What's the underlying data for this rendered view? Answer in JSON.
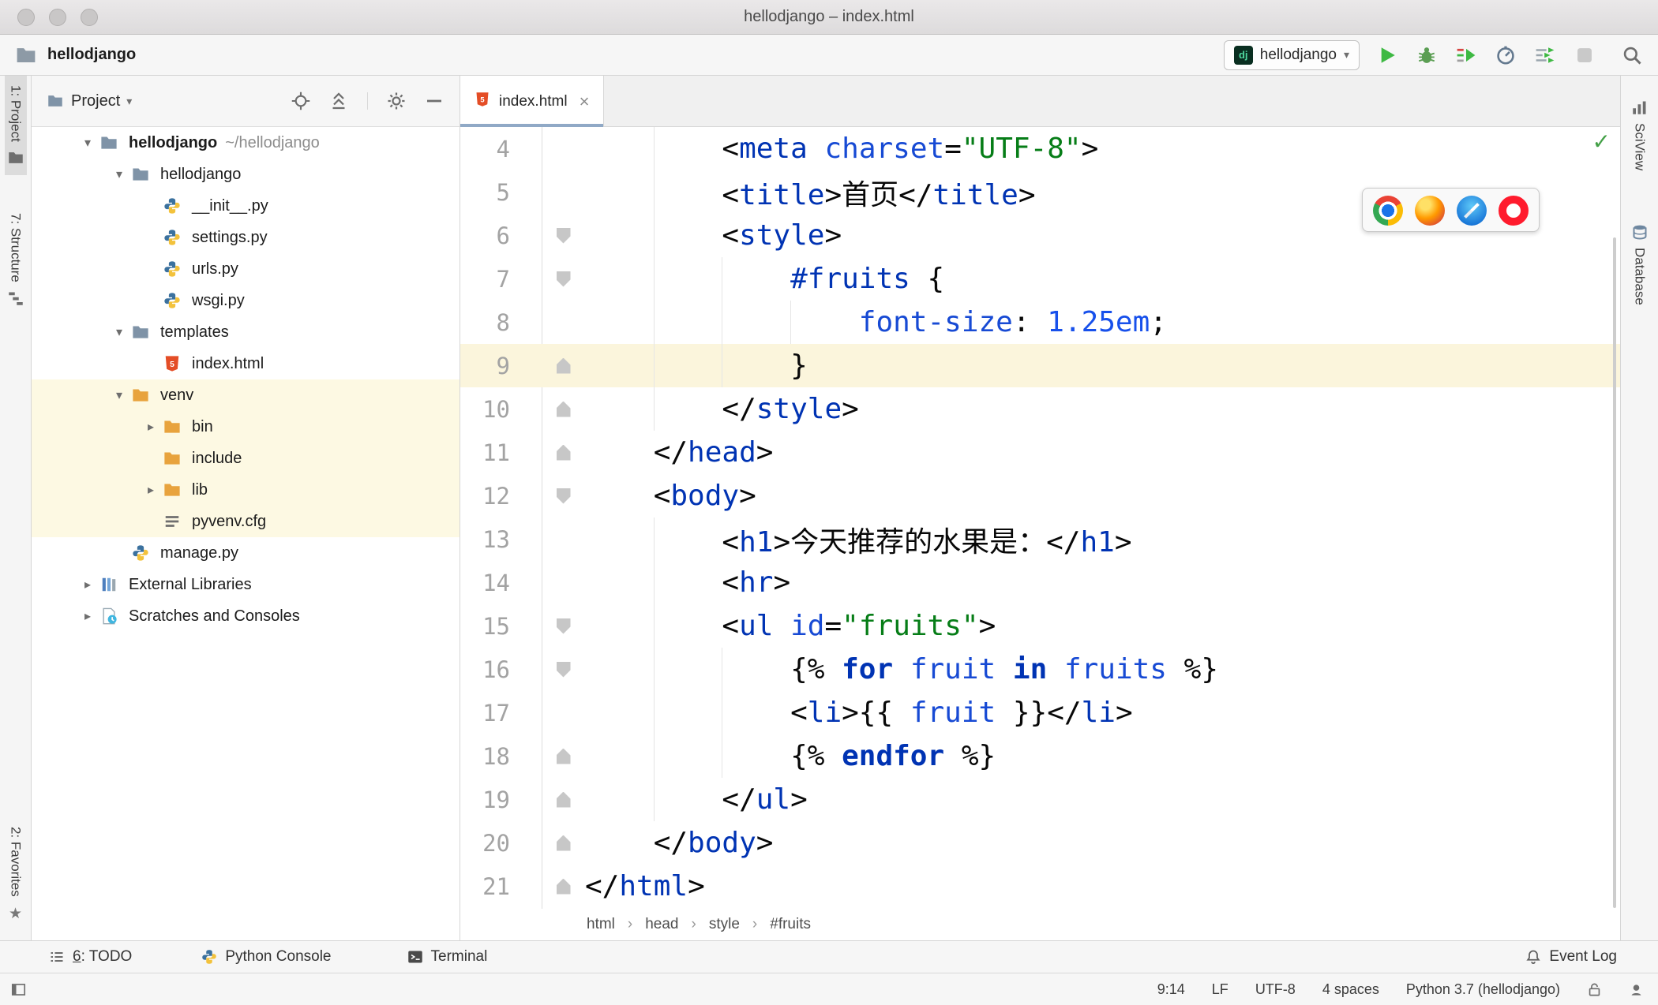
{
  "window": {
    "title": "hellodjango – index.html"
  },
  "toolbar": {
    "project_name": "hellodjango",
    "config_badge": "dj",
    "run_config": "hellodjango"
  },
  "left_stripe": {
    "project": "1: Project",
    "structure": "7: Structure",
    "favorites": "2: Favorites"
  },
  "right_stripe": {
    "sciview": "SciView",
    "database": "Database"
  },
  "project_panel": {
    "header": "Project",
    "tree": [
      {
        "label": "hellodjango",
        "hint": "~/hellodjango",
        "level": 0,
        "icon": "folder",
        "arrow": "down",
        "bold": true
      },
      {
        "label": "hellodjango",
        "level": 1,
        "icon": "folder",
        "arrow": "down"
      },
      {
        "label": "__init__.py",
        "level": 2,
        "icon": "python"
      },
      {
        "label": "settings.py",
        "level": 2,
        "icon": "python"
      },
      {
        "label": "urls.py",
        "level": 2,
        "icon": "python"
      },
      {
        "label": "wsgi.py",
        "level": 2,
        "icon": "python"
      },
      {
        "label": "templates",
        "level": 1,
        "icon": "folder",
        "arrow": "down"
      },
      {
        "label": "index.html",
        "level": 2,
        "icon": "html"
      },
      {
        "label": "venv",
        "level": 1,
        "icon": "folder-orange",
        "arrow": "down",
        "highlight": true
      },
      {
        "label": "bin",
        "level": 2,
        "icon": "folder-orange",
        "arrow": "right",
        "highlight": true
      },
      {
        "label": "include",
        "level": 2,
        "icon": "folder-orange",
        "highlight": true
      },
      {
        "label": "lib",
        "level": 2,
        "icon": "folder-orange",
        "arrow": "right",
        "highlight": true
      },
      {
        "label": "pyvenv.cfg",
        "level": 2,
        "icon": "cfg",
        "highlight": true
      },
      {
        "label": "manage.py",
        "level": 1,
        "icon": "python"
      },
      {
        "label": "External Libraries",
        "level": 0,
        "icon": "libs",
        "arrow": "right"
      },
      {
        "label": "Scratches and Consoles",
        "level": 0,
        "icon": "scratches",
        "arrow": "right"
      }
    ]
  },
  "editor": {
    "tab_label": "index.html",
    "breadcrumbs": [
      "html",
      "head",
      "style",
      "#fruits"
    ],
    "browser_icons": [
      "chrome",
      "firefox",
      "safari",
      "opera"
    ],
    "lines": [
      {
        "num": 4,
        "seg": [
          [
            "p",
            "        <"
          ],
          [
            "t",
            "meta"
          ],
          [
            "p",
            " "
          ],
          [
            "a",
            "charset"
          ],
          [
            "p",
            "="
          ],
          [
            "s",
            "\"UTF-8\""
          ],
          [
            "p",
            ">"
          ]
        ]
      },
      {
        "num": 5,
        "seg": [
          [
            "p",
            "        <"
          ],
          [
            "t",
            "title"
          ],
          [
            "p",
            ">首页</"
          ],
          [
            "t",
            "title"
          ],
          [
            "p",
            ">"
          ]
        ]
      },
      {
        "num": 6,
        "fold": "down",
        "seg": [
          [
            "p",
            "        <"
          ],
          [
            "t",
            "style"
          ],
          [
            "p",
            ">"
          ]
        ]
      },
      {
        "num": 7,
        "fold": "down",
        "seg": [
          [
            "p",
            "            "
          ],
          [
            "t",
            "#fruits"
          ],
          [
            "p",
            " {"
          ]
        ]
      },
      {
        "num": 8,
        "seg": [
          [
            "p",
            "                "
          ],
          [
            "a",
            "font-size"
          ],
          [
            "p",
            ": "
          ],
          [
            "n",
            "1.25em"
          ],
          [
            "p",
            ";"
          ]
        ]
      },
      {
        "num": 9,
        "fold": "up",
        "current": true,
        "seg": [
          [
            "p",
            "            }"
          ]
        ]
      },
      {
        "num": 10,
        "fold": "up",
        "seg": [
          [
            "p",
            "        </"
          ],
          [
            "t",
            "style"
          ],
          [
            "p",
            ">"
          ]
        ]
      },
      {
        "num": 11,
        "fold": "up",
        "seg": [
          [
            "p",
            "    </"
          ],
          [
            "t",
            "head"
          ],
          [
            "p",
            ">"
          ]
        ]
      },
      {
        "num": 12,
        "fold": "down",
        "seg": [
          [
            "p",
            "    <"
          ],
          [
            "t",
            "body"
          ],
          [
            "p",
            ">"
          ]
        ]
      },
      {
        "num": 13,
        "seg": [
          [
            "p",
            "        <"
          ],
          [
            "t",
            "h1"
          ],
          [
            "p",
            ">今天推荐的水果是：</"
          ],
          [
            "t",
            "h1"
          ],
          [
            "p",
            ">"
          ]
        ]
      },
      {
        "num": 14,
        "seg": [
          [
            "p",
            "        <"
          ],
          [
            "t",
            "hr"
          ],
          [
            "p",
            ">"
          ]
        ]
      },
      {
        "num": 15,
        "fold": "down",
        "seg": [
          [
            "p",
            "        <"
          ],
          [
            "t",
            "ul"
          ],
          [
            "p",
            " "
          ],
          [
            "a",
            "id"
          ],
          [
            "p",
            "="
          ],
          [
            "s",
            "\"fruits\""
          ],
          [
            "p",
            ">"
          ]
        ]
      },
      {
        "num": 16,
        "fold": "down",
        "seg": [
          [
            "p",
            "            {% "
          ],
          [
            "k",
            "for"
          ],
          [
            "p",
            " "
          ],
          [
            "v",
            "fruit"
          ],
          [
            "p",
            " "
          ],
          [
            "k",
            "in"
          ],
          [
            "p",
            " "
          ],
          [
            "v",
            "fruits"
          ],
          [
            "p",
            " %}"
          ]
        ]
      },
      {
        "num": 17,
        "seg": [
          [
            "p",
            "            <"
          ],
          [
            "t",
            "li"
          ],
          [
            "p",
            ">{{ "
          ],
          [
            "v",
            "fruit"
          ],
          [
            "p",
            " }}</"
          ],
          [
            "t",
            "li"
          ],
          [
            "p",
            ">"
          ]
        ]
      },
      {
        "num": 18,
        "fold": "up",
        "seg": [
          [
            "p",
            "            {% "
          ],
          [
            "k",
            "endfor"
          ],
          [
            "p",
            " %}"
          ]
        ]
      },
      {
        "num": 19,
        "fold": "up",
        "seg": [
          [
            "p",
            "        </"
          ],
          [
            "t",
            "ul"
          ],
          [
            "p",
            ">"
          ]
        ]
      },
      {
        "num": 20,
        "fold": "up",
        "seg": [
          [
            "p",
            "    </"
          ],
          [
            "t",
            "body"
          ],
          [
            "p",
            ">"
          ]
        ]
      },
      {
        "num": 21,
        "fold": "up",
        "seg": [
          [
            "p",
            "</"
          ],
          [
            "t",
            "html"
          ],
          [
            "p",
            ">"
          ]
        ]
      }
    ]
  },
  "bottom_bar": {
    "todo_mnemonic": "6",
    "todo_rest": ": TODO",
    "python_console": "Python Console",
    "terminal": "Terminal",
    "event_log": "Event Log"
  },
  "status_bar": {
    "caret": "9:14",
    "line_ending": "LF",
    "encoding": "UTF-8",
    "indent": "4 spaces",
    "interpreter": "Python 3.7 (hellodjango)"
  },
  "colors": {
    "tag": "#0033b3",
    "attribute": "#174ad4",
    "string": "#067d17",
    "number": "#1750eb",
    "keyword": "#0033b3",
    "current_line": "#fbf5dc",
    "venv_highlight": "#fdf9e3",
    "run_green": "#3eb943"
  }
}
